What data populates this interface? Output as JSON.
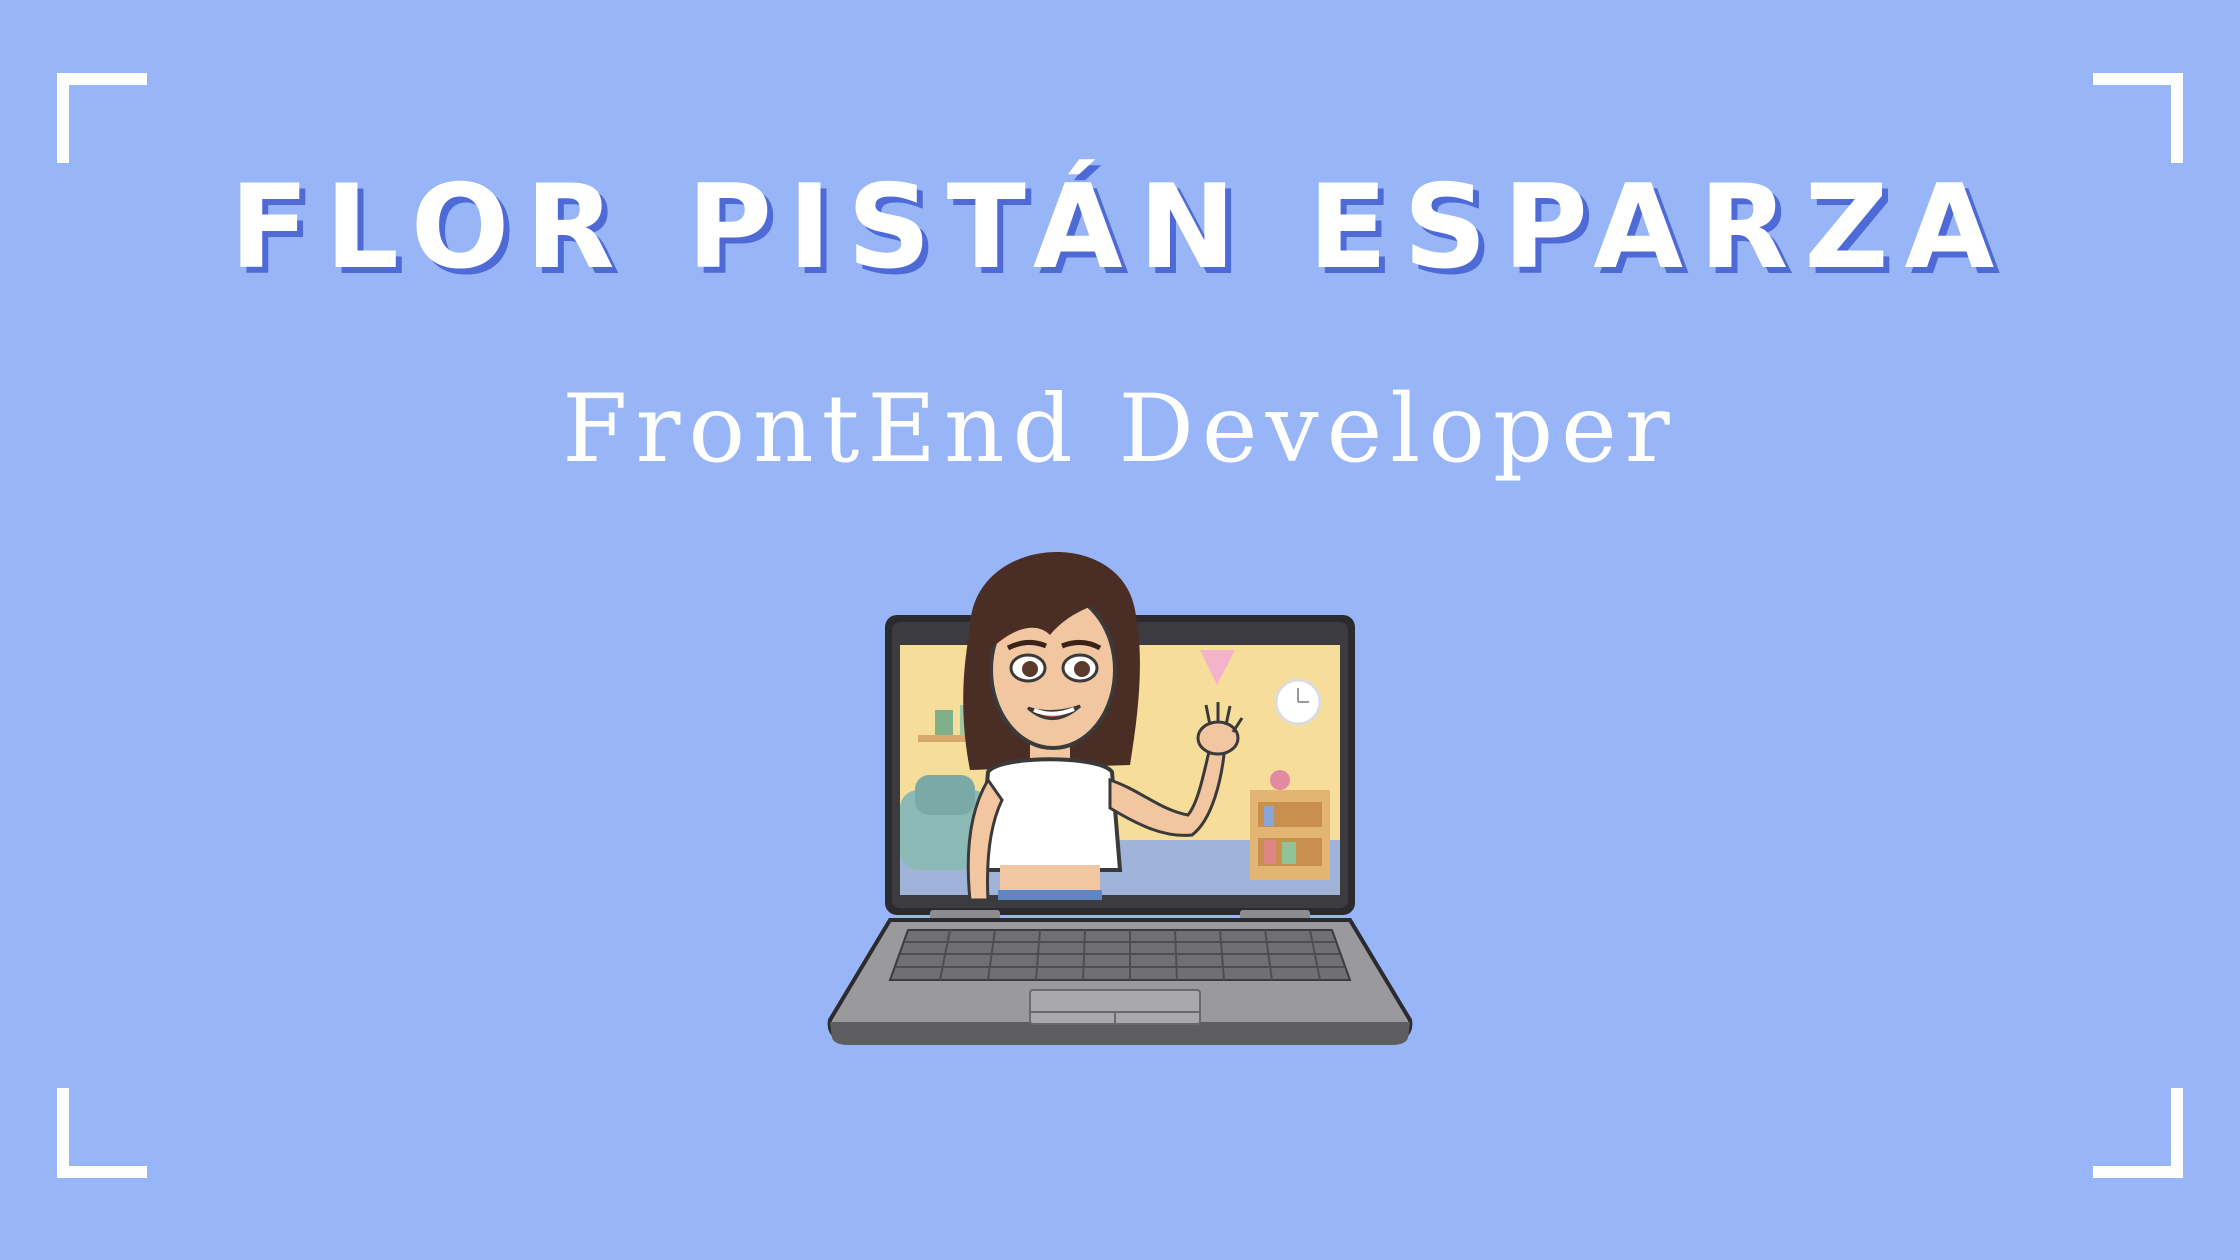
{
  "header": {
    "name": "FLOR PISTÁN ESPARZA",
    "role": "FrontEnd Developer"
  },
  "colors": {
    "background": "#98b5f7",
    "text": "#ffffff",
    "title_shadow": "#4e6ad6"
  },
  "illustration": {
    "icon": "laptop-avatar-waving-icon"
  }
}
